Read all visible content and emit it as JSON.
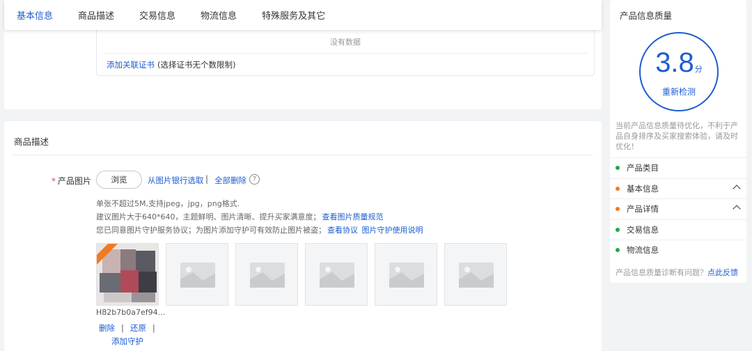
{
  "tabs": [
    {
      "label": "基本信息",
      "active": true
    },
    {
      "label": "商品描述",
      "active": false
    },
    {
      "label": "交易信息",
      "active": false
    },
    {
      "label": "物流信息",
      "active": false
    },
    {
      "label": "特殊服务及其它",
      "active": false
    }
  ],
  "certificates": {
    "empty_text": "没有数据",
    "add_link": "添加关联证书",
    "add_note": "(选择证书无个数限制)"
  },
  "description": {
    "section_title": "商品描述",
    "required_mark": "*",
    "field_label": "产品图片",
    "browse_label": "浏览",
    "bank_link": "从图片银行选取",
    "separator": "|",
    "delete_all_link": "全部删除",
    "help_icon_glyph": "?",
    "hint_line1": "单张不超过5M,支持jpeg，jpg，png格式.",
    "hint_line2": "建议图片大于640*640，主题鲜明、图片清晰、提升买家满意度；",
    "hint_line2_link": "查看图片质量规范",
    "hint_line3": "您已同意图片守护服务协议；为图片添加守护可有效防止图片被盗；",
    "hint_line3_link1": "查看协议",
    "hint_line3_link2": "图片守护使用说明",
    "uploaded_filename": "H82b7b0a7ef94...",
    "delete_label": "删除",
    "restore_label": "还原",
    "bar": "|",
    "add_guard_label": "添加守护",
    "placeholder_count": 5
  },
  "quality_panel": {
    "title": "产品信息质量",
    "score": "3.8",
    "score_unit": "分",
    "recheck_label": "重新检测",
    "message": "当前产品信息质量待优化，不利于产品自身排序及买家搜索体验，请及时优化！",
    "items": [
      {
        "label": "产品类目",
        "status_color": "#22a845",
        "expandable": false
      },
      {
        "label": "基本信息",
        "status_color": "#f07a23",
        "expandable": true
      },
      {
        "label": "产品详情",
        "status_color": "#f07a23",
        "expandable": true
      },
      {
        "label": "交易信息",
        "status_color": "#22a845",
        "expandable": false
      },
      {
        "label": "物流信息",
        "status_color": "#22a845",
        "expandable": false
      }
    ],
    "footer_text": "产品信息质量诊断有问题？",
    "footer_link": "点此反馈"
  },
  "colors": {
    "accent": "#1d5cd1",
    "required": "#e54545"
  }
}
